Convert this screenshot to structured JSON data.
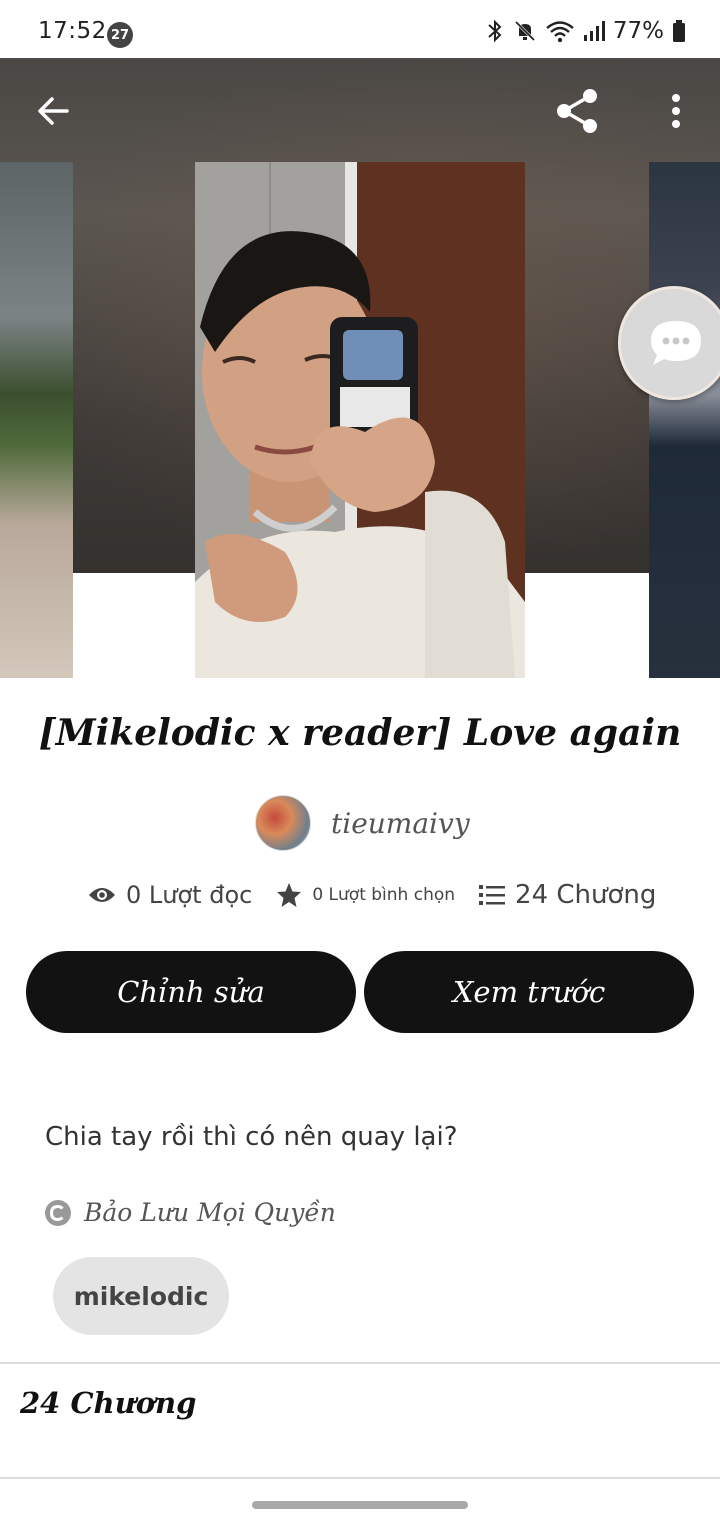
{
  "status_bar": {
    "time": "17:52",
    "notification_count": "27",
    "battery": "77%",
    "icons": [
      "bluetooth-icon",
      "mute-icon",
      "wifi-icon",
      "signal-icon",
      "battery-icon"
    ]
  },
  "header": {
    "icons": [
      "back-arrow-icon",
      "share-icon",
      "more-vert-icon",
      "chat-bubble-icon"
    ]
  },
  "story": {
    "title": "[Mikelodic x reader] Love again",
    "author": "tieumaivy",
    "stats": {
      "reads": "0 Lượt đọc",
      "votes": "0 Lượt bình chọn",
      "chapters": "24 Chương"
    },
    "description": "Chia tay rồi thì có nên quay lại?",
    "copyright": "Bảo Lưu Mọi Quyền",
    "tags": [
      "mikelodic"
    ]
  },
  "actions": {
    "edit_label": "Chỉnh sửa",
    "preview_label": "Xem trước"
  },
  "chapters_section": {
    "heading": "24 Chương"
  },
  "colors": {
    "button_bg": "#121212",
    "tag_bg": "#e4e4e4",
    "text_primary": "#111111"
  }
}
